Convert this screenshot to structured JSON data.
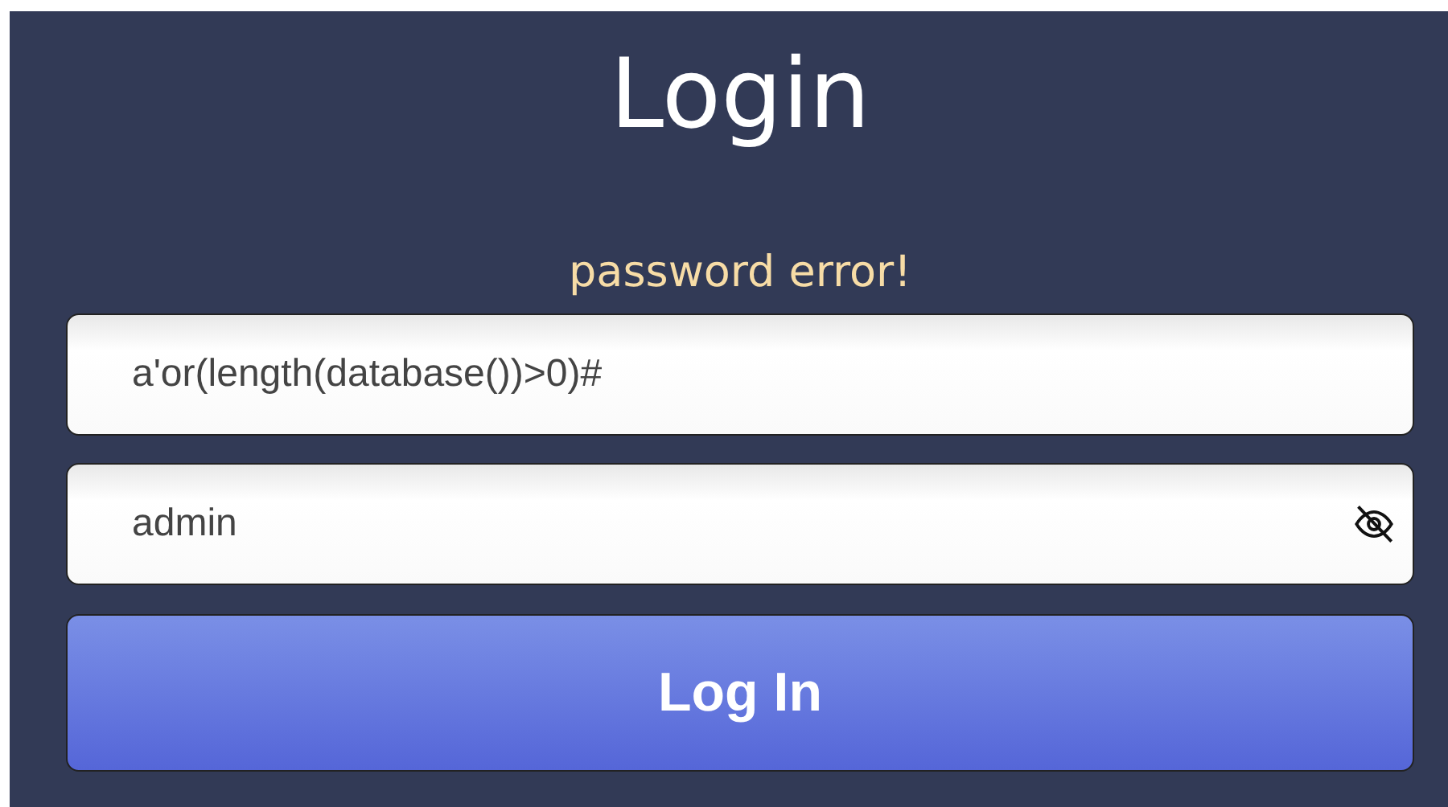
{
  "title": "Login",
  "error": "password error!",
  "username": {
    "value": "a'or(length(database())>0)#"
  },
  "password": {
    "value": "admin",
    "revealed": true
  },
  "submit": "Log In"
}
